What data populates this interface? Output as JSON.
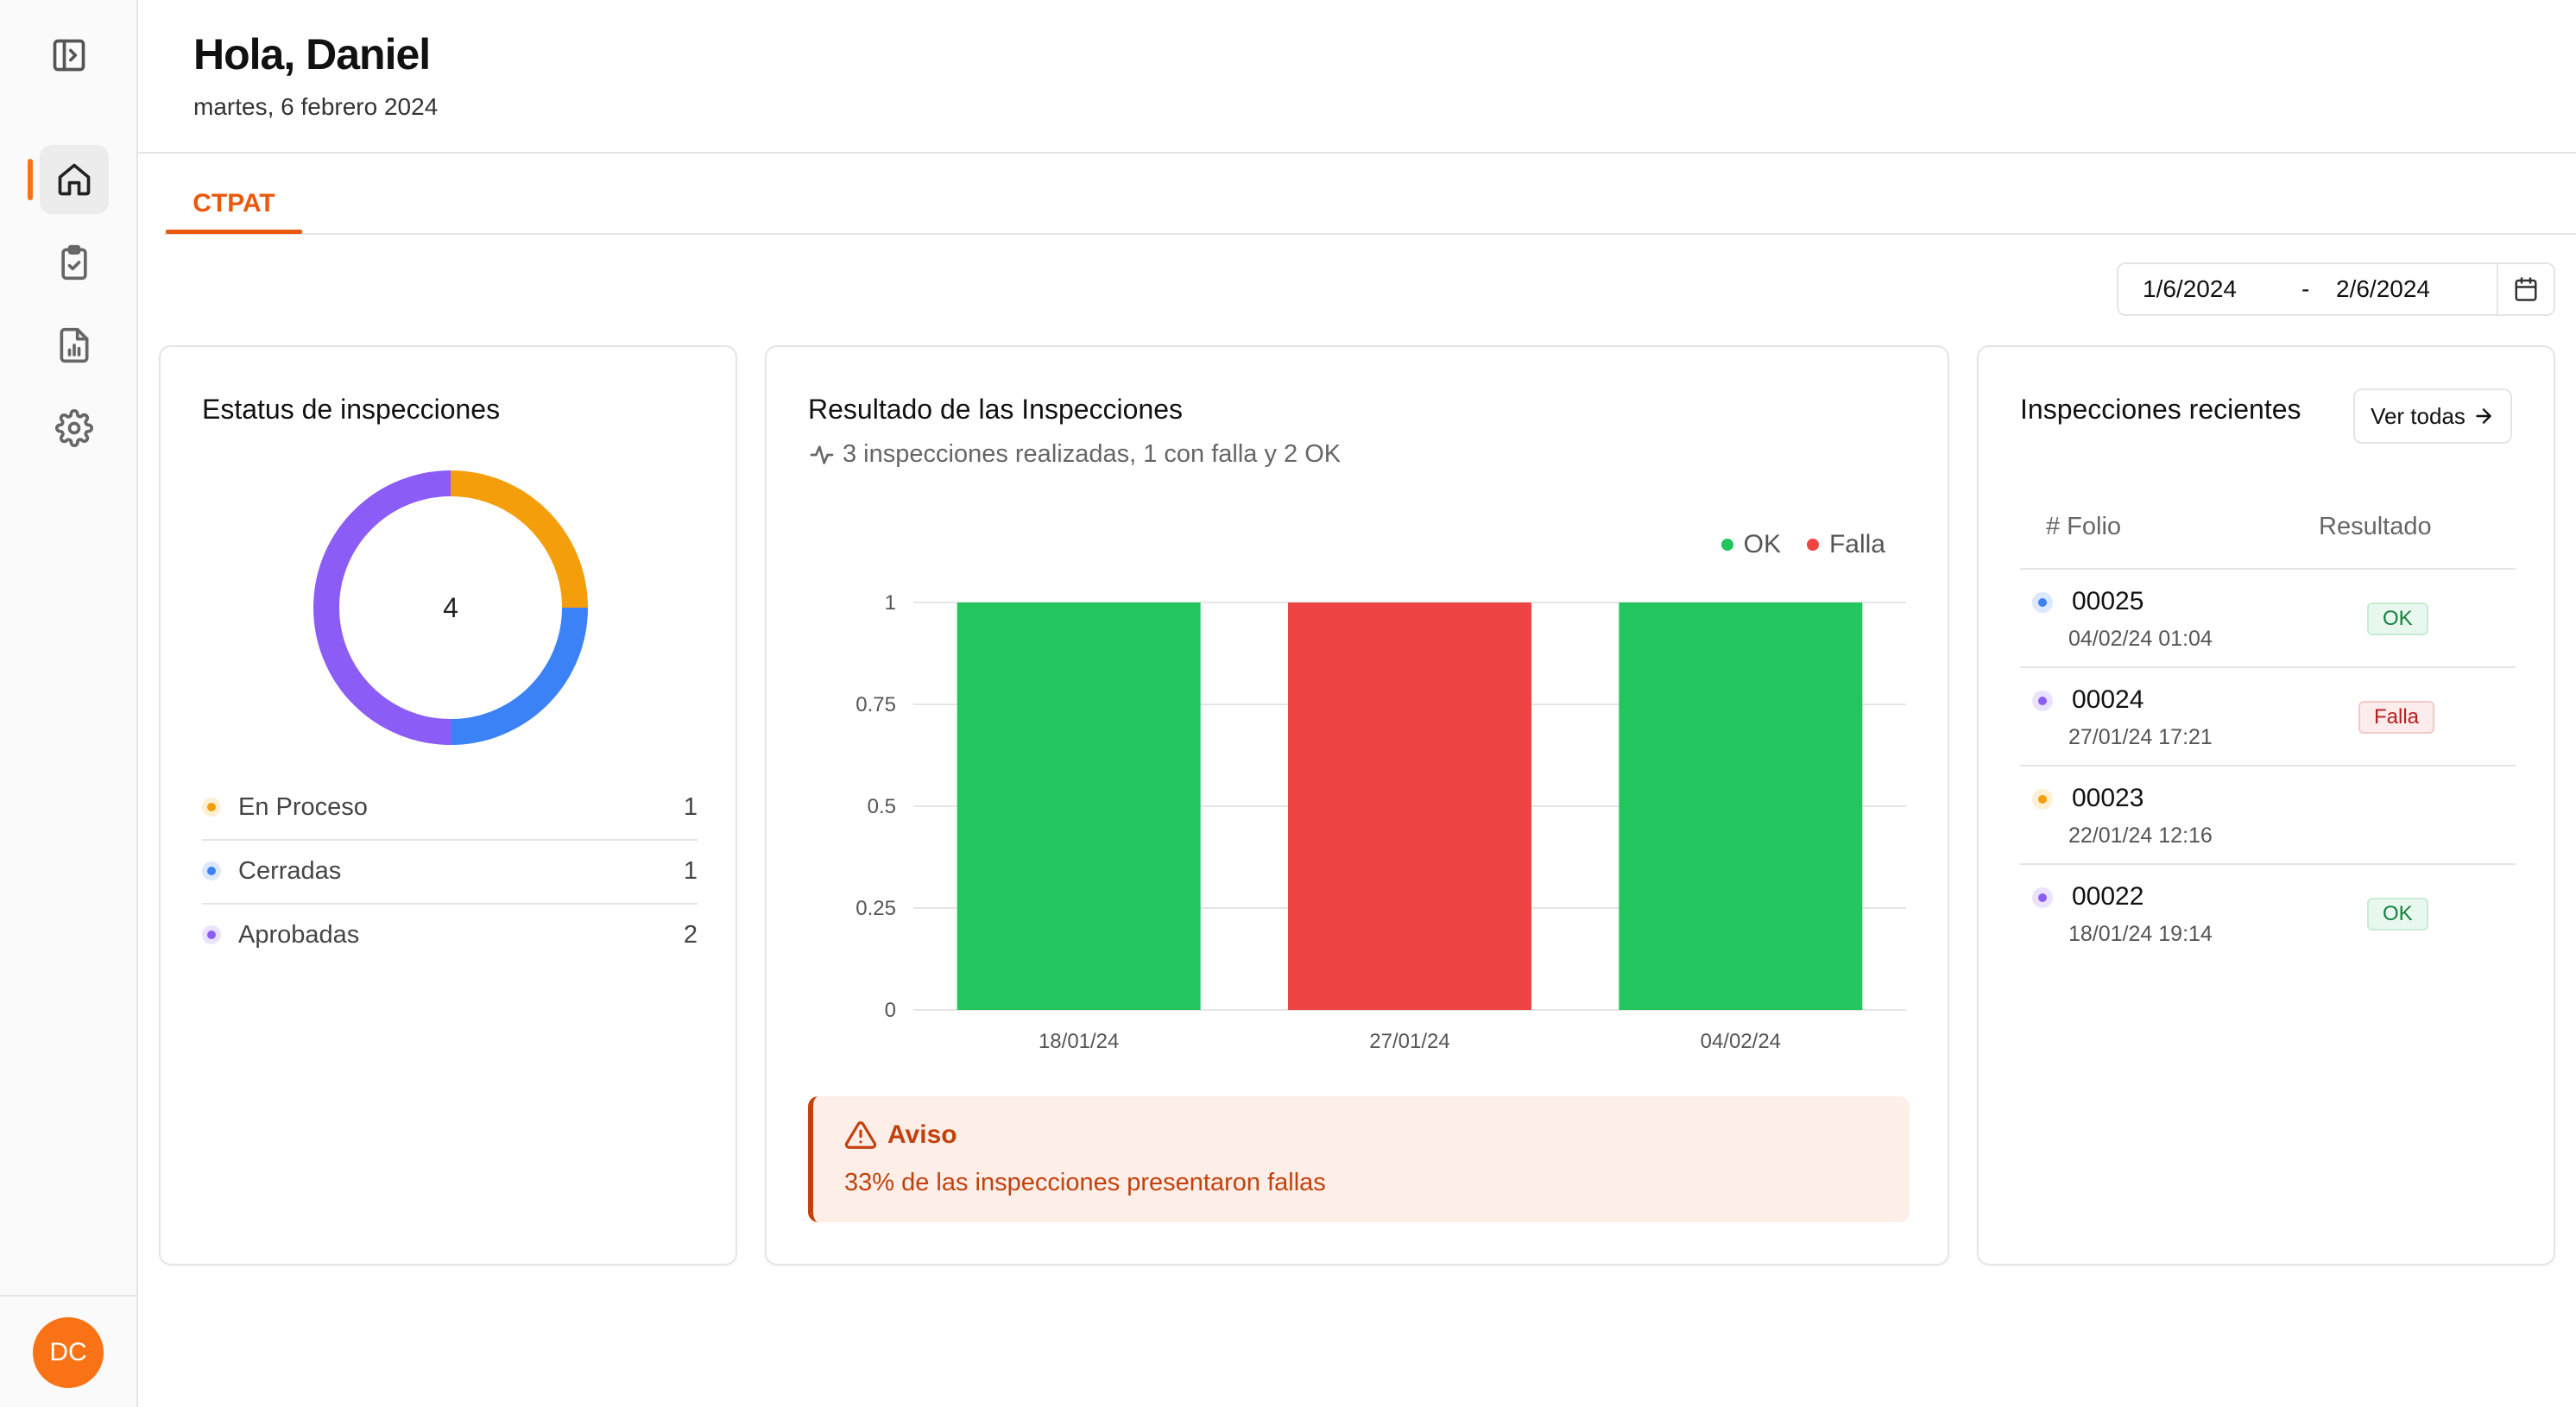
{
  "colors": {
    "accent": "#f97316",
    "ok": "#22c55e",
    "falla": "#ef4444",
    "en_proceso": "#f59e0b",
    "cerradas": "#3b82f6",
    "aprobadas": "#8b5cf6",
    "warning_text": "#c2410c",
    "warning_bg": "#fdeee8"
  },
  "sidebar": {
    "items": [
      {
        "icon": "panel-toggle-icon"
      },
      {
        "icon": "home-icon",
        "active": true
      },
      {
        "icon": "clipboard-check-icon"
      },
      {
        "icon": "report-chart-icon"
      },
      {
        "icon": "gear-icon"
      }
    ],
    "avatar_initials": "DC"
  },
  "header": {
    "greeting": "Hola, Daniel",
    "date": "martes, 6 febrero 2024"
  },
  "tabs": [
    {
      "label": "CTPAT",
      "active": true
    }
  ],
  "date_range": {
    "start": "1/6/2024",
    "separator": "-",
    "end": "2/6/2024"
  },
  "status_card": {
    "title": "Estatus de inspecciones",
    "total": "4",
    "items": [
      {
        "label": "En Proceso",
        "count": "1",
        "color": "#f59e0b"
      },
      {
        "label": "Cerradas",
        "count": "1",
        "color": "#3b82f6"
      },
      {
        "label": "Aprobadas",
        "count": "2",
        "color": "#8b5cf6"
      }
    ]
  },
  "results_card": {
    "title": "Resultado de las Inspecciones",
    "subtitle": "3 inspecciones realizadas, 1 con falla y 2 OK",
    "legend": [
      {
        "label": "OK",
        "color": "#22c55e"
      },
      {
        "label": "Falla",
        "color": "#ef4444"
      }
    ],
    "alert": {
      "title": "Aviso",
      "message": "33% de las inspecciones presentaron fallas"
    }
  },
  "recent_card": {
    "title": "Inspecciones recientes",
    "view_all_label": "Ver todas",
    "columns": [
      "# Folio",
      "Resultado"
    ],
    "rows": [
      {
        "folio": "00025",
        "date": "04/02/24 01:04",
        "result": "OK",
        "dot_color": "#3b82f6"
      },
      {
        "folio": "00024",
        "date": "27/01/24 17:21",
        "result": "Falla",
        "dot_color": "#8b5cf6"
      },
      {
        "folio": "00023",
        "date": "22/01/24 12:16",
        "result": "",
        "dot_color": "#f59e0b"
      },
      {
        "folio": "00022",
        "date": "18/01/24 19:14",
        "result": "OK",
        "dot_color": "#8b5cf6"
      }
    ]
  },
  "chart_data": [
    {
      "type": "pie",
      "variant": "donut",
      "categories": [
        "En Proceso",
        "Cerradas",
        "Aprobadas"
      ],
      "values": [
        1,
        1,
        2
      ],
      "colors": [
        "#f59e0b",
        "#3b82f6",
        "#8b5cf6"
      ],
      "center_label": "4"
    },
    {
      "type": "bar",
      "categories": [
        "18/01/24",
        "27/01/24",
        "04/02/24"
      ],
      "values": [
        1,
        1,
        1
      ],
      "bar_results": [
        "OK",
        "Falla",
        "OK"
      ],
      "bar_colors": [
        "#22c55e",
        "#ef4444",
        "#22c55e"
      ],
      "yticks": [
        "0",
        "0.25",
        "0.5",
        "0.75",
        "1"
      ],
      "ylim": [
        0,
        1
      ],
      "grid": true,
      "legend_position": "top-right"
    }
  ]
}
